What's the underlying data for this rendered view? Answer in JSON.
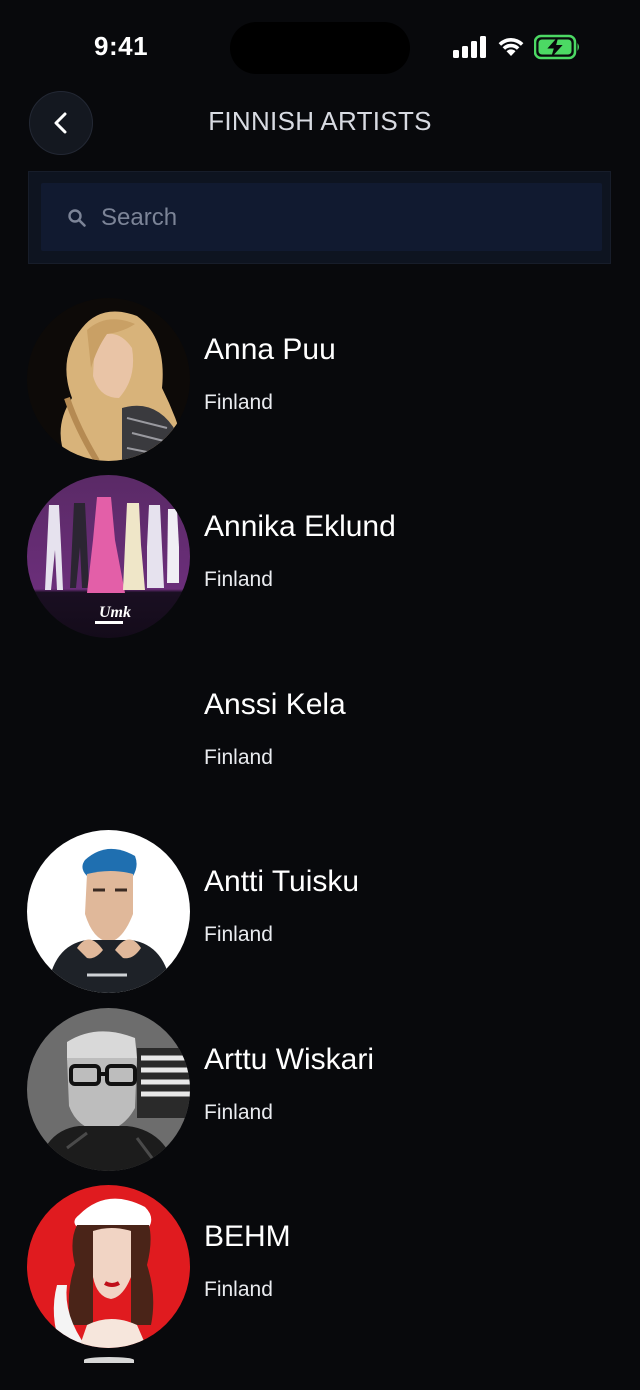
{
  "status": {
    "time": "9:41"
  },
  "header": {
    "title": "FINNISH ARTISTS",
    "back_icon": "chevron-left-icon"
  },
  "search": {
    "placeholder": "Search",
    "value": "",
    "icon": "search-icon"
  },
  "artists": [
    {
      "name": "Anna Puu",
      "country": "Finland",
      "has_photo": true
    },
    {
      "name": "Annika Eklund",
      "country": "Finland",
      "has_photo": true
    },
    {
      "name": "Anssi Kela",
      "country": "Finland",
      "has_photo": false
    },
    {
      "name": "Antti Tuisku",
      "country": "Finland",
      "has_photo": true
    },
    {
      "name": "Arttu Wiskari",
      "country": "Finland",
      "has_photo": true
    },
    {
      "name": "BEHM",
      "country": "Finland",
      "has_photo": true
    }
  ],
  "colors": {
    "background": "#08090c",
    "search_field": "#111a30",
    "battery_green": "#4cd964"
  }
}
